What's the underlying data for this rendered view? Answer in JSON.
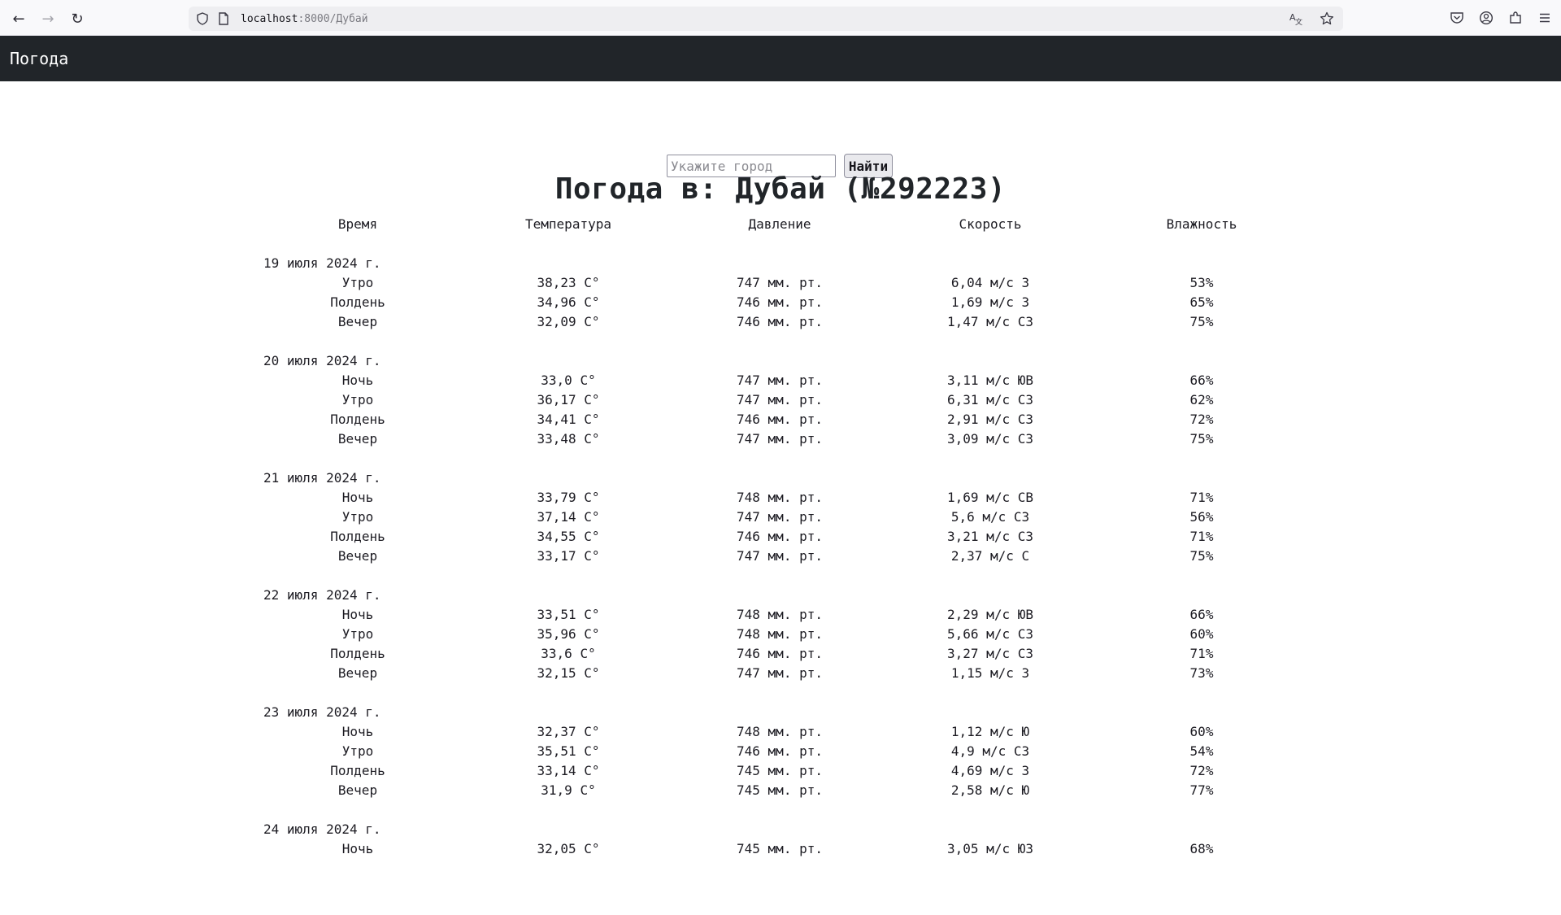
{
  "browser": {
    "back_icon": "←",
    "forward_icon": "→",
    "reload_icon": "↻",
    "url_host": "localhost",
    "url_rest": ":8000/Дубай"
  },
  "header": {
    "brand": "Погода"
  },
  "search": {
    "placeholder": "Укажите город",
    "value": "",
    "button_label": "Найти"
  },
  "title": "Погода в: Дубай (№292223)",
  "columns": [
    "Время",
    "Температура",
    "Давление",
    "Скорость",
    "Влажность"
  ],
  "days": [
    {
      "date": "19 июля 2024 г.",
      "rows": [
        {
          "time": "Утро",
          "temp": "38,23 C°",
          "pressure": "747 мм. рт.",
          "wind": "6,04 м/с З",
          "humidity": "53%"
        },
        {
          "time": "Полдень",
          "temp": "34,96 C°",
          "pressure": "746 мм. рт.",
          "wind": "1,69 м/с З",
          "humidity": "65%"
        },
        {
          "time": "Вечер",
          "temp": "32,09 C°",
          "pressure": "746 мм. рт.",
          "wind": "1,47 м/с СЗ",
          "humidity": "75%"
        }
      ]
    },
    {
      "date": "20 июля 2024 г.",
      "rows": [
        {
          "time": "Ночь",
          "temp": "33,0 C°",
          "pressure": "747 мм. рт.",
          "wind": "3,11 м/с ЮВ",
          "humidity": "66%"
        },
        {
          "time": "Утро",
          "temp": "36,17 C°",
          "pressure": "747 мм. рт.",
          "wind": "6,31 м/с СЗ",
          "humidity": "62%"
        },
        {
          "time": "Полдень",
          "temp": "34,41 C°",
          "pressure": "746 мм. рт.",
          "wind": "2,91 м/с СЗ",
          "humidity": "72%"
        },
        {
          "time": "Вечер",
          "temp": "33,48 C°",
          "pressure": "747 мм. рт.",
          "wind": "3,09 м/с СЗ",
          "humidity": "75%"
        }
      ]
    },
    {
      "date": "21 июля 2024 г.",
      "rows": [
        {
          "time": "Ночь",
          "temp": "33,79 C°",
          "pressure": "748 мм. рт.",
          "wind": "1,69 м/с СВ",
          "humidity": "71%"
        },
        {
          "time": "Утро",
          "temp": "37,14 C°",
          "pressure": "747 мм. рт.",
          "wind": "5,6 м/с СЗ",
          "humidity": "56%"
        },
        {
          "time": "Полдень",
          "temp": "34,55 C°",
          "pressure": "746 мм. рт.",
          "wind": "3,21 м/с СЗ",
          "humidity": "71%"
        },
        {
          "time": "Вечер",
          "temp": "33,17 C°",
          "pressure": "747 мм. рт.",
          "wind": "2,37 м/с С",
          "humidity": "75%"
        }
      ]
    },
    {
      "date": "22 июля 2024 г.",
      "rows": [
        {
          "time": "Ночь",
          "temp": "33,51 C°",
          "pressure": "748 мм. рт.",
          "wind": "2,29 м/с ЮВ",
          "humidity": "66%"
        },
        {
          "time": "Утро",
          "temp": "35,96 C°",
          "pressure": "748 мм. рт.",
          "wind": "5,66 м/с СЗ",
          "humidity": "60%"
        },
        {
          "time": "Полдень",
          "temp": "33,6 C°",
          "pressure": "746 мм. рт.",
          "wind": "3,27 м/с СЗ",
          "humidity": "71%"
        },
        {
          "time": "Вечер",
          "temp": "32,15 C°",
          "pressure": "747 мм. рт.",
          "wind": "1,15 м/с З",
          "humidity": "73%"
        }
      ]
    },
    {
      "date": "23 июля 2024 г.",
      "rows": [
        {
          "time": "Ночь",
          "temp": "32,37 C°",
          "pressure": "748 мм. рт.",
          "wind": "1,12 м/с Ю",
          "humidity": "60%"
        },
        {
          "time": "Утро",
          "temp": "35,51 C°",
          "pressure": "746 мм. рт.",
          "wind": "4,9 м/с СЗ",
          "humidity": "54%"
        },
        {
          "time": "Полдень",
          "temp": "33,14 C°",
          "pressure": "745 мм. рт.",
          "wind": "4,69 м/с З",
          "humidity": "72%"
        },
        {
          "time": "Вечер",
          "temp": "31,9 C°",
          "pressure": "745 мм. рт.",
          "wind": "2,58 м/с Ю",
          "humidity": "77%"
        }
      ]
    },
    {
      "date": "24 июля 2024 г.",
      "rows": [
        {
          "time": "Ночь",
          "temp": "32,05 C°",
          "pressure": "745 мм. рт.",
          "wind": "3,05 м/с ЮЗ",
          "humidity": "68%"
        }
      ]
    }
  ]
}
